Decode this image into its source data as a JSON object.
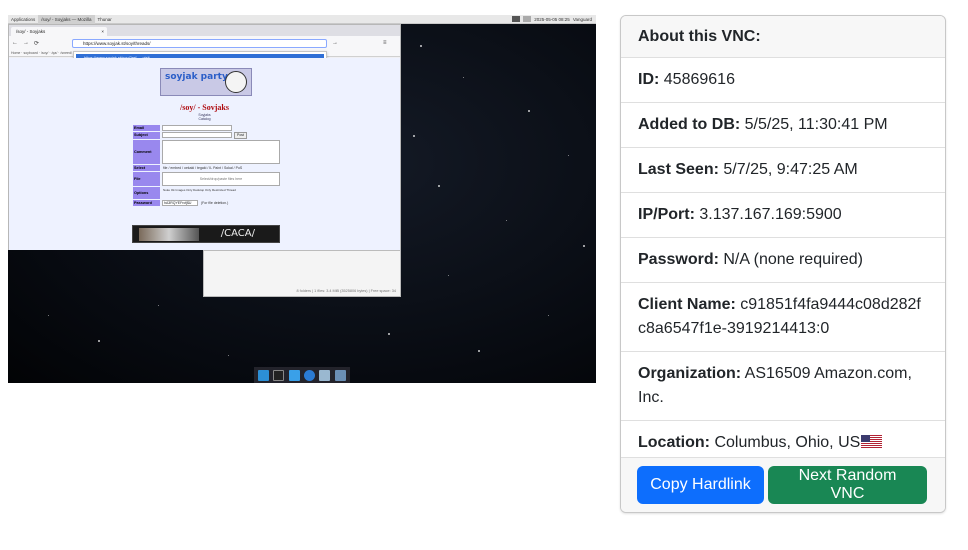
{
  "vnc": {
    "taskbar": {
      "apps_label": "Applications",
      "tabs": [
        "/soy/ - Soyjaks — Mozilla",
        "Thunar"
      ],
      "clock": "2025-05-05 08:25",
      "user": "Vanguard"
    },
    "browser": {
      "tab_title": "/soy/ - Soyjaks",
      "url": "https://www.soyjak.st/soy/threads/",
      "suggestion": "https://www.soyjak.st/soy/?ref — visit",
      "search_hint": "This time, search with:",
      "bookmarks": "Home · soyboard · /soy/ · /qa/ · /sneed/"
    },
    "board": {
      "logo_text": "soyjak party",
      "title": "/soy/ - Sovjaks",
      "subtitle_1": "Soyjaks",
      "subtitle_2": "Catalog",
      "form": {
        "email": "Email",
        "subject": "Subject",
        "post_button": "Post",
        "comment": "Comment",
        "select": "Select",
        "select_values": "file / embed / oekaki / tegaki / IL Paint / Sokal / PoS",
        "file": "File",
        "file_hint": "Select/drop/paste files here",
        "options": "Options",
        "options_values": "Nuke Ok   Images Only   Desktop Only   Restricted Thread",
        "password": "Password",
        "password_value": "hA3RQYEFrcfj$U",
        "password_hint": "(For file deletion.)"
      },
      "banner_text": "/CACA/"
    },
    "filemanager": {
      "status": "8 folders | 1 files: 3.4 MiB (3525806 bytes) | Free space: 34"
    }
  },
  "info": {
    "header": "About this VNC:",
    "id_label": "ID:",
    "id_value": "45869616",
    "added_label": "Added to DB:",
    "added_value": "5/5/25, 11:30:41 PM",
    "seen_label": "Last Seen:",
    "seen_value": "5/7/25, 9:47:25 AM",
    "ip_label": "IP/Port:",
    "ip_value": "3.137.167.169:5900",
    "password_label": "Password:",
    "password_value": "N/A (none required)",
    "client_label": "Client Name:",
    "client_value": "c91851f4fa9444c08d282fc8a6547f1e-3919214413:0",
    "org_label": "Organization:",
    "org_value": "AS16509 Amazon.com, Inc.",
    "location_label": "Location:",
    "location_value": "Columbus, Ohio, US",
    "flag_icon": "us-flag-icon"
  },
  "buttons": {
    "copy_hardlink": "Copy Hardlink",
    "next_random": "Next Random VNC"
  },
  "colors": {
    "primary": "#0d6efd",
    "success": "#198754",
    "board_title": "#af0a0f",
    "form_label": "#9988ee"
  }
}
